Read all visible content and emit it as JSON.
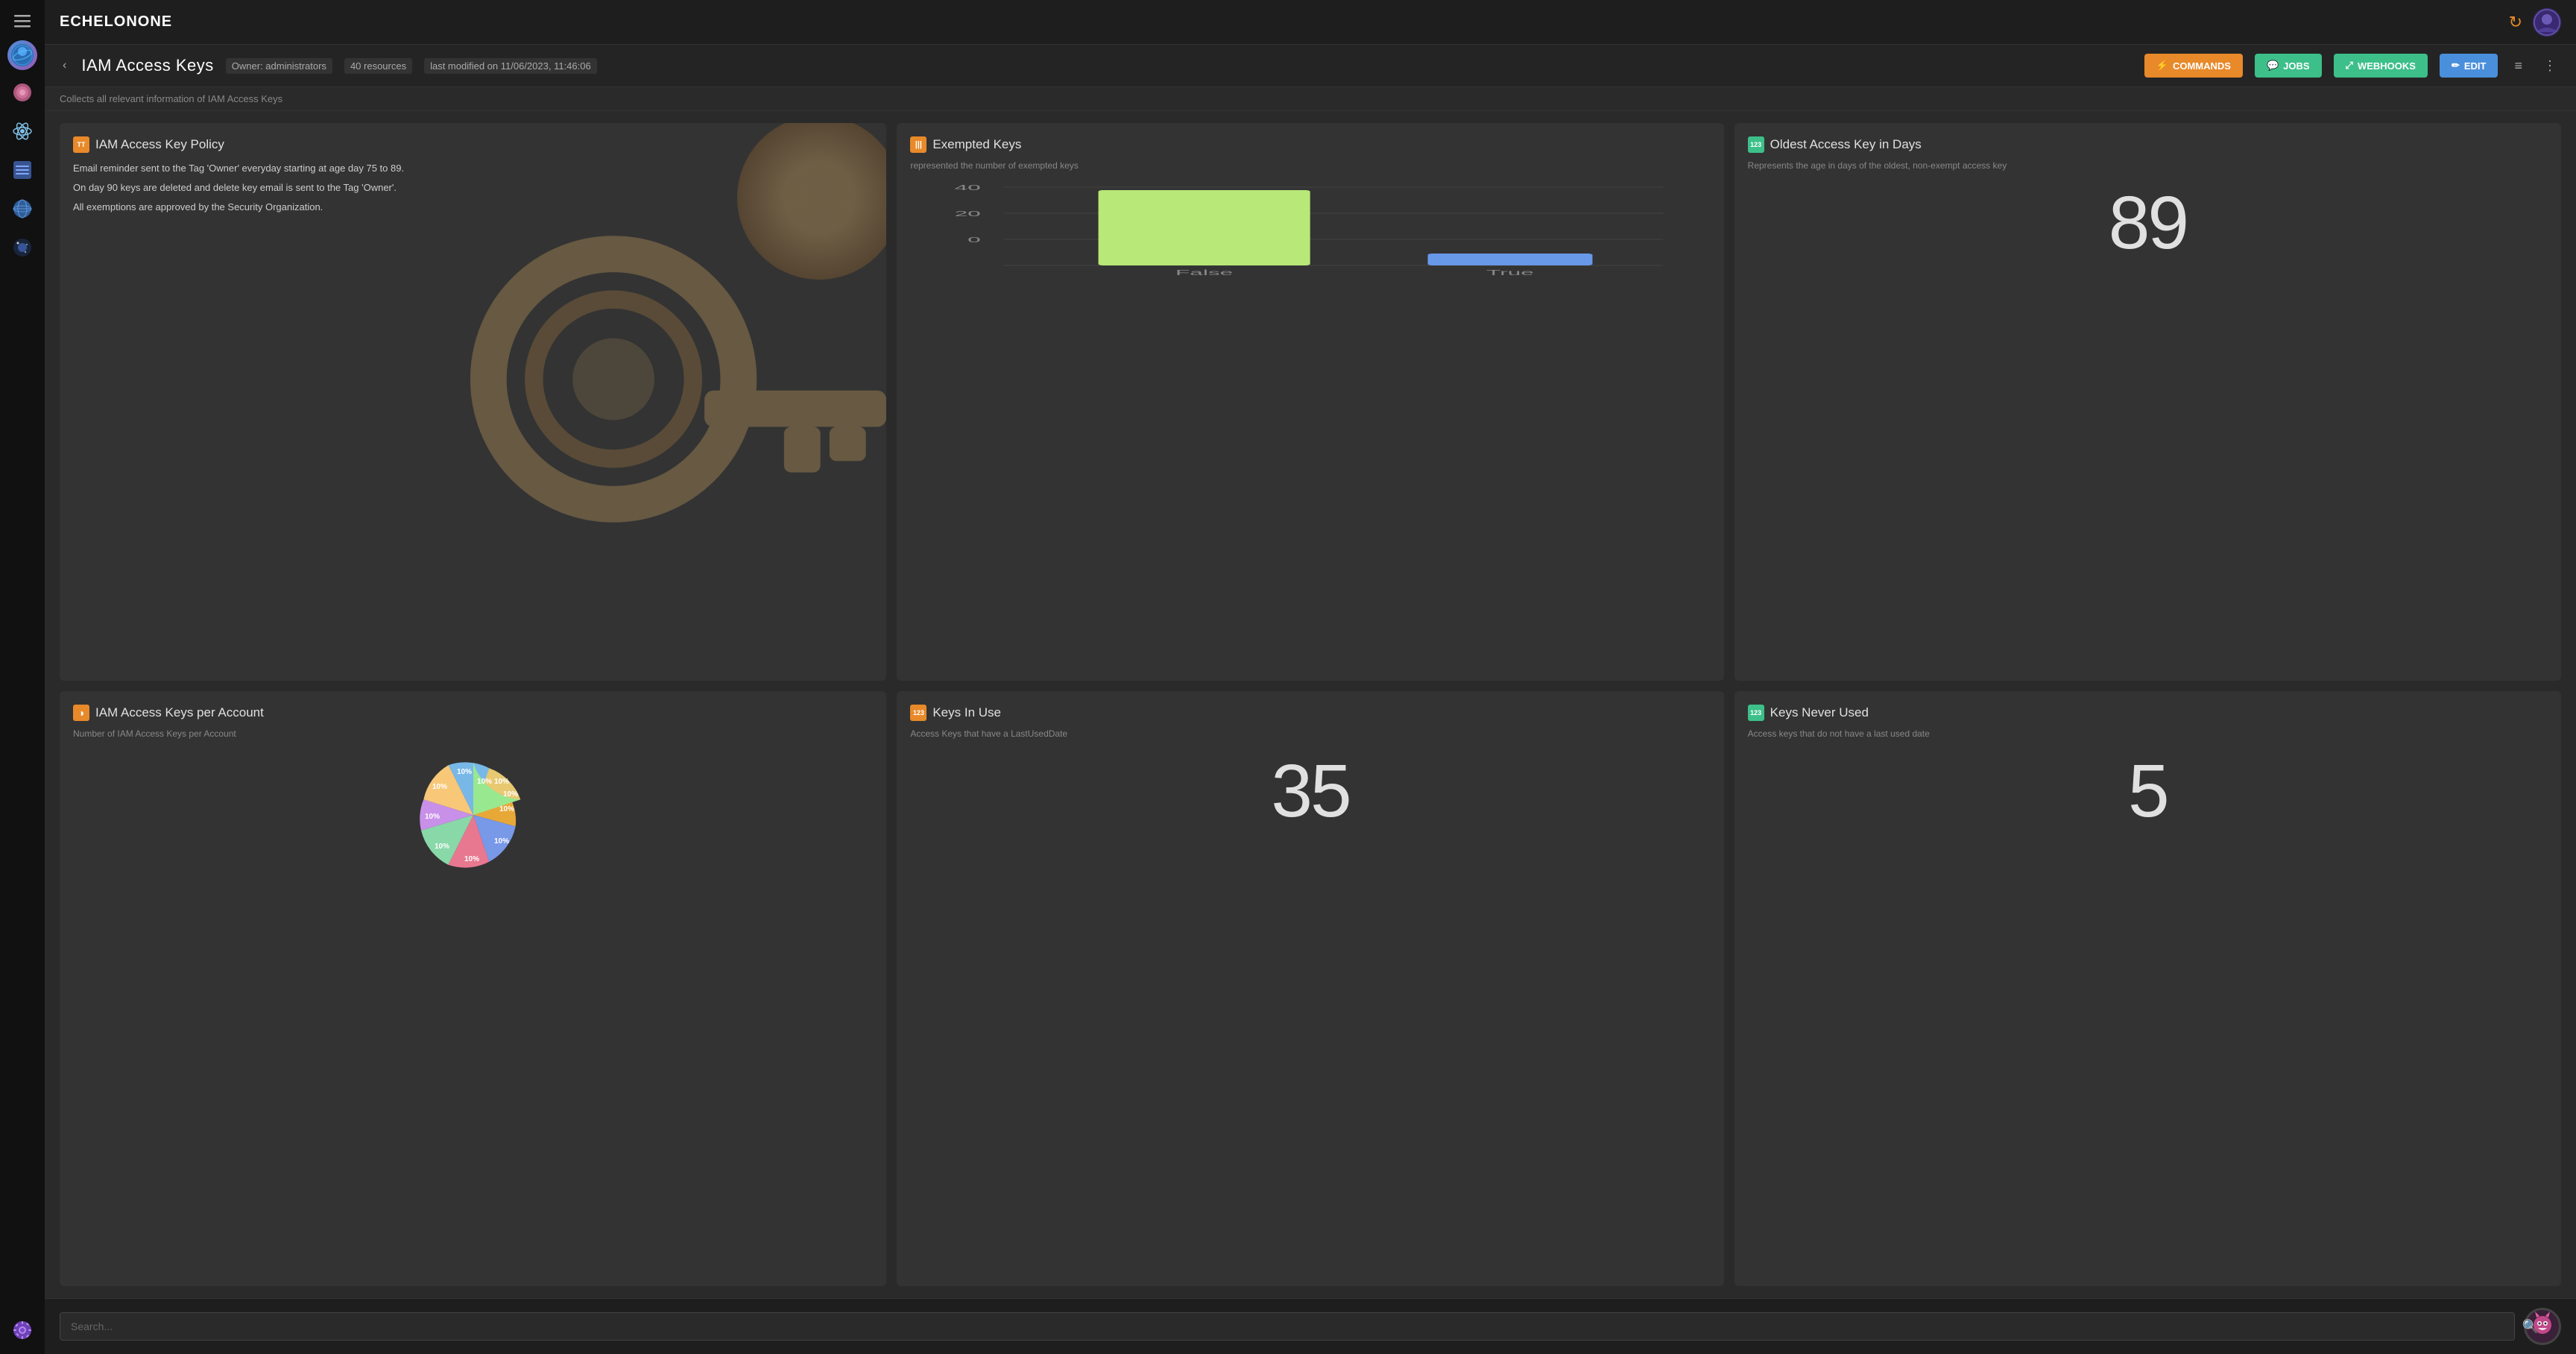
{
  "sidebar": {
    "menu_icon": "≡",
    "nav_items": [
      {
        "name": "dashboard-icon",
        "label": "Dashboard",
        "symbol": "🌐"
      },
      {
        "name": "explore-icon",
        "label": "Explore",
        "symbol": "🔮"
      },
      {
        "name": "atom-icon",
        "label": "Atom",
        "symbol": "⚛"
      },
      {
        "name": "network-icon",
        "label": "Network",
        "symbol": "📡"
      },
      {
        "name": "globe-icon",
        "label": "Globe",
        "symbol": "🌍"
      },
      {
        "name": "space-icon",
        "label": "Space",
        "symbol": "🌌"
      },
      {
        "name": "settings-icon",
        "label": "Settings",
        "symbol": "⚙"
      }
    ]
  },
  "topbar": {
    "logo": "ECHELONONE",
    "refresh_icon": "↻"
  },
  "content_header": {
    "back_label": "‹",
    "title": "IAM Access Keys",
    "owner_label": "Owner: administrators",
    "resources_label": "40 resources",
    "last_modified_label": "last modified on 11/06/2023, 11:46:06",
    "commands_label": "COMMANDS",
    "jobs_label": "JOBS",
    "webhooks_label": "WEBHOOKS",
    "edit_label": "EDIT",
    "filter_icon": "≡",
    "more_icon": "⋮"
  },
  "sub_header": {
    "description": "Collects all relevant information of IAM Access Keys"
  },
  "cards": {
    "policy": {
      "title": "IAM Access Key Policy",
      "icon_label": "TT",
      "text_lines": [
        "Email reminder sent to the Tag 'Owner' everyday starting at age day 75 to 89.",
        "On day 90 keys are deleted and delete key email is sent to the Tag 'Owner'.",
        "All exemptions are approved by the Security Organization."
      ]
    },
    "exempted_keys": {
      "title": "Exempted Keys",
      "icon_label": "|||",
      "subtitle": "represented the number of exempted keys",
      "bar_false_value": 36,
      "bar_true_value": 4,
      "bar_max": 40,
      "labels": [
        "False",
        "True"
      ],
      "y_labels": [
        "40",
        "20",
        "0"
      ]
    },
    "oldest_access_key": {
      "title": "Oldest Access Key in Days",
      "icon_label": "123",
      "subtitle": "Represents the age in days of the oldest, non-exempt access key",
      "value": "89"
    },
    "keys_per_account": {
      "title": "IAM Access Keys per Account",
      "icon_label": "◑",
      "subtitle": "Number of IAM Access Keys per Account",
      "slices": [
        {
          "label": "10%",
          "color": "#a8d878"
        },
        {
          "label": "10%",
          "color": "#e8a838"
        },
        {
          "label": "10%",
          "color": "#7898e8"
        },
        {
          "label": "10%",
          "color": "#e87890"
        },
        {
          "label": "10%",
          "color": "#88d8a8"
        },
        {
          "label": "10%",
          "color": "#c890e8"
        },
        {
          "label": "10%",
          "color": "#f8c878"
        },
        {
          "label": "10%",
          "color": "#78b8e8"
        },
        {
          "label": "10%",
          "color": "#e8c870"
        },
        {
          "label": "10%",
          "color": "#98e890"
        }
      ]
    },
    "keys_in_use": {
      "title": "Keys In Use",
      "icon_label": "123",
      "subtitle": "Access Keys that have a LastUsedDate",
      "value": "35"
    },
    "keys_never_used": {
      "title": "Keys Never Used",
      "icon_label": "123",
      "subtitle": "Access keys that do not have a last used date",
      "value": "5"
    }
  },
  "search": {
    "placeholder": "Search..."
  }
}
